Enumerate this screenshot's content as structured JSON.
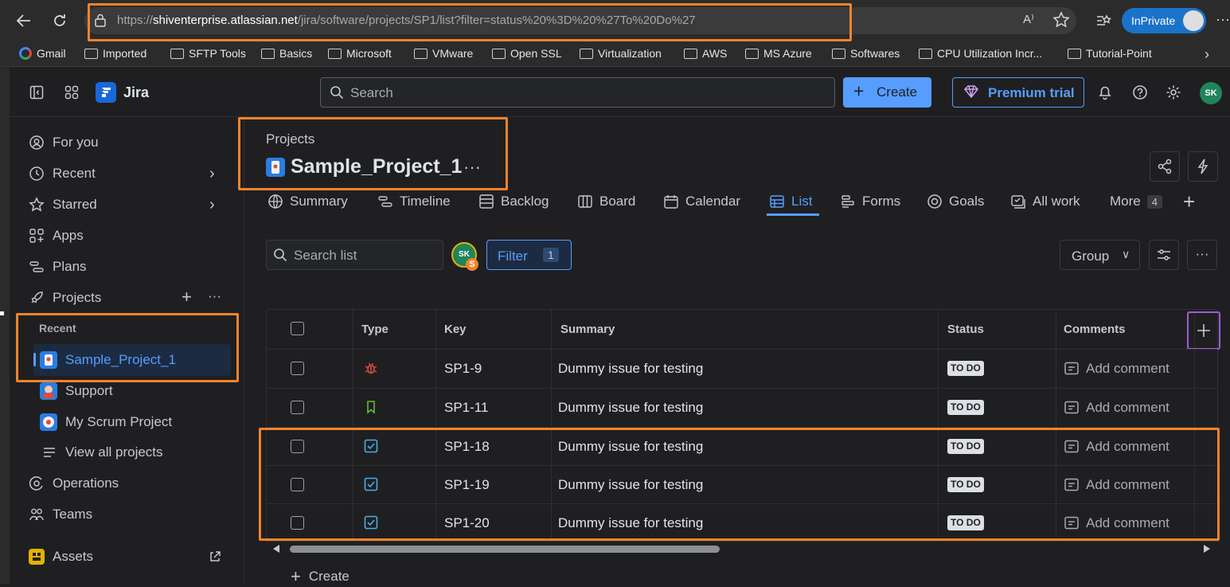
{
  "browser": {
    "url_prefix": "https://",
    "url_host": "shiventerprise.atlassian.net",
    "url_path": "/jira/software/projects/SP1/list?filter=status%20%3D%20%27To%20Do%27",
    "inprivate_label": "InPrivate"
  },
  "bookmarks": [
    {
      "label": "Gmail"
    },
    {
      "label": "Imported"
    },
    {
      "label": "SFTP Tools"
    },
    {
      "label": "Basics"
    },
    {
      "label": "Microsoft"
    },
    {
      "label": "VMware"
    },
    {
      "label": "Open SSL"
    },
    {
      "label": "Virtualization"
    },
    {
      "label": "AWS"
    },
    {
      "label": "MS Azure"
    },
    {
      "label": "Softwares"
    },
    {
      "label": "CPU Utilization Incr..."
    },
    {
      "label": "Tutorial-Point"
    }
  ],
  "topnav": {
    "app_name": "Jira",
    "search_placeholder": "Search",
    "create_label": "Create",
    "premium_label": "Premium trial",
    "user_initials": "SK"
  },
  "sidebar": {
    "items": [
      {
        "label": "For you"
      },
      {
        "label": "Recent"
      },
      {
        "label": "Starred"
      },
      {
        "label": "Apps"
      },
      {
        "label": "Plans"
      },
      {
        "label": "Projects"
      }
    ],
    "recent_label": "Recent",
    "projects": [
      {
        "label": "Sample_Project_1"
      },
      {
        "label": "Support"
      },
      {
        "label": "My Scrum Project"
      }
    ],
    "view_all": "View all projects",
    "bottom_items": [
      {
        "label": "Operations"
      },
      {
        "label": "Teams"
      },
      {
        "label": "Assets"
      }
    ]
  },
  "project": {
    "breadcrumb": "Projects",
    "title": "Sample_Project_1"
  },
  "tabs": [
    {
      "label": "Summary"
    },
    {
      "label": "Timeline"
    },
    {
      "label": "Backlog"
    },
    {
      "label": "Board"
    },
    {
      "label": "Calendar"
    },
    {
      "label": "List"
    },
    {
      "label": "Forms"
    },
    {
      "label": "Goals"
    },
    {
      "label": "All work"
    },
    {
      "label": "More"
    }
  ],
  "more_count": "4",
  "toolbar": {
    "search_placeholder": "Search list",
    "avatar_initials": "SK",
    "avatar_badge": "S",
    "filter_label": "Filter",
    "filter_count": "1",
    "group_label": "Group"
  },
  "table": {
    "headers": {
      "type": "Type",
      "key": "Key",
      "summary": "Summary",
      "status": "Status",
      "comments": "Comments"
    },
    "rows": [
      {
        "type": "bug",
        "key": "SP1-9",
        "summary": "Dummy issue for testing",
        "status": "TO DO",
        "comment": "Add comment"
      },
      {
        "type": "story",
        "key": "SP1-11",
        "summary": "Dummy issue for testing",
        "status": "TO DO",
        "comment": "Add comment"
      },
      {
        "type": "task",
        "key": "SP1-18",
        "summary": "Dummy issue for testing",
        "status": "TO DO",
        "comment": "Add comment"
      },
      {
        "type": "task",
        "key": "SP1-19",
        "summary": "Dummy issue for testing",
        "status": "TO DO",
        "comment": "Add comment"
      },
      {
        "type": "task",
        "key": "SP1-20",
        "summary": "Dummy issue for testing",
        "status": "TO DO",
        "comment": "Add comment"
      }
    ],
    "create_label": "Create"
  },
  "colors": {
    "accent": "#579dff",
    "highlight": "#f0832c",
    "add_column_highlight": "#a05ad8",
    "bug": "#e5493a",
    "story": "#63ba3c",
    "task": "#4bade8"
  }
}
